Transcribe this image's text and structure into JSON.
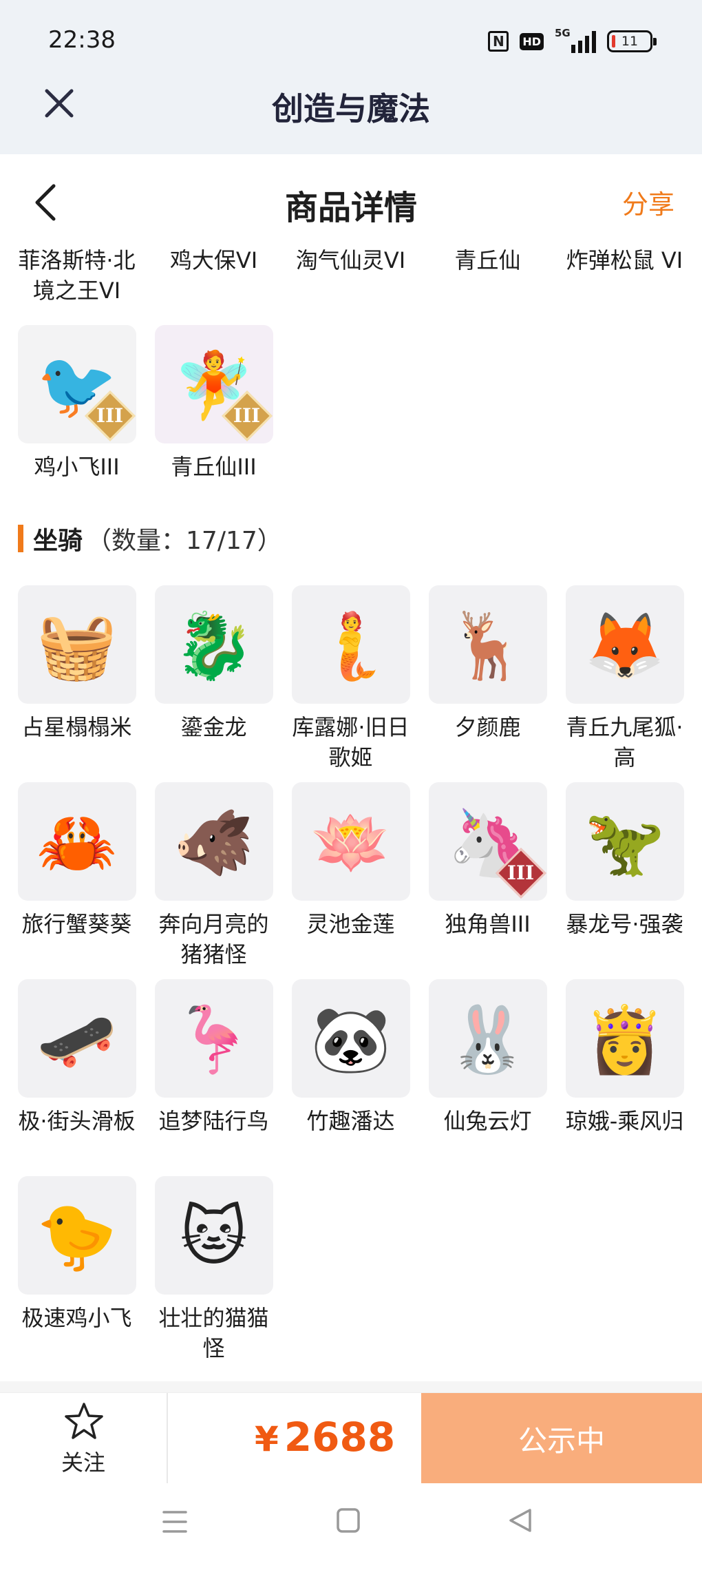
{
  "status": {
    "time": "22:38",
    "network": "5G",
    "battery": "11"
  },
  "app": {
    "title": "创造与魔法"
  },
  "header": {
    "title": "商品详情",
    "share": "分享"
  },
  "top_row": [
    "菲洛斯特·北境之王VI",
    "鸡大保VI",
    "淘气仙灵VI",
    "青丘仙",
    "炸弹松鼠 VI"
  ],
  "pets_extra": [
    {
      "name": "鸡小飞III",
      "icon": "blue-chick-icon",
      "level": "III"
    },
    {
      "name": "青丘仙III",
      "icon": "fox-fairy-icon",
      "level": "III"
    }
  ],
  "mounts": {
    "title": "坐骑",
    "count": "（数量：17/17）",
    "items": [
      {
        "name": "占星榻榻米",
        "icon": "astrology-mat-icon"
      },
      {
        "name": "鎏金龙",
        "icon": "golden-dragon-icon"
      },
      {
        "name": "库露娜·旧日歌姬",
        "icon": "singer-icon"
      },
      {
        "name": "夕颜鹿",
        "icon": "deer-icon"
      },
      {
        "name": "青丘九尾狐·高",
        "icon": "nine-tail-fox-icon"
      },
      {
        "name": "旅行蟹葵葵",
        "icon": "crab-icon"
      },
      {
        "name": "奔向月亮的猪猪怪",
        "icon": "pig-icon"
      },
      {
        "name": "灵池金莲",
        "icon": "golden-lotus-icon"
      },
      {
        "name": "独角兽III",
        "icon": "unicorn-icon",
        "level": "III"
      },
      {
        "name": "暴龙号·强袭",
        "icon": "mech-dragon-icon"
      },
      {
        "name": "极·街头滑板",
        "icon": "skateboard-icon"
      },
      {
        "name": "追梦陆行鸟",
        "icon": "running-bird-icon"
      },
      {
        "name": "竹趣潘达",
        "icon": "panda-icon"
      },
      {
        "name": "仙兔云灯",
        "icon": "rabbit-lantern-icon"
      },
      {
        "name": "琼娥-乘风归",
        "icon": "moon-fairy-icon"
      },
      {
        "name": "极速鸡小飞",
        "icon": "fast-chick-icon"
      },
      {
        "name": "壮壮的猫猫怪",
        "icon": "cat-icon"
      }
    ]
  },
  "footer": {
    "follow": "关注",
    "currency": "¥",
    "price": "2688",
    "status_button": "公示中"
  },
  "colors": {
    "accent": "#f07a1a",
    "price": "#f05a12",
    "cta": "#f9ad7c"
  }
}
